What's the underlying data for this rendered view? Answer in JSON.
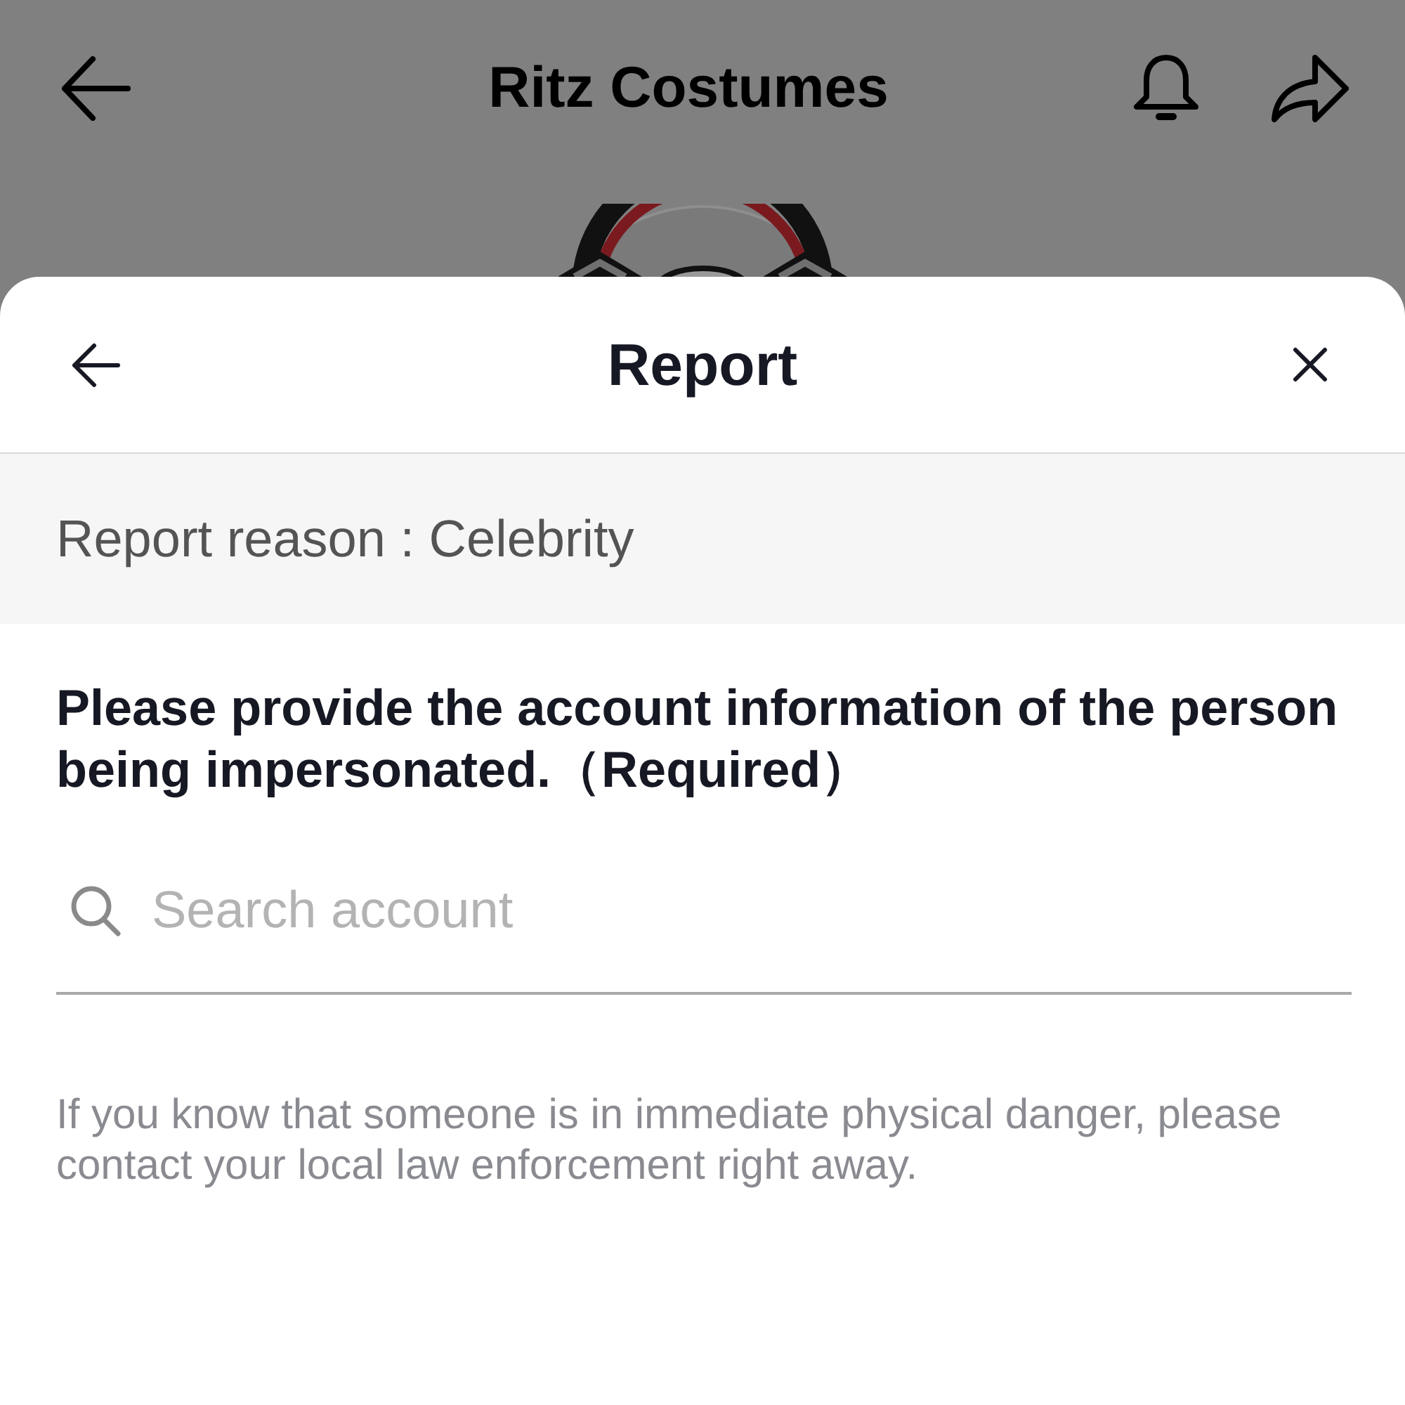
{
  "background_page": {
    "title": "Ritz Costumes"
  },
  "report_sheet": {
    "title": "Report",
    "reason": "Report reason : Celebrity",
    "question": "Please provide the account information of the person being impersonated.（Required）",
    "search": {
      "placeholder": "Search account"
    },
    "notice": "If you know that someone is in immediate physical danger, please contact your local law enforcement right away."
  }
}
